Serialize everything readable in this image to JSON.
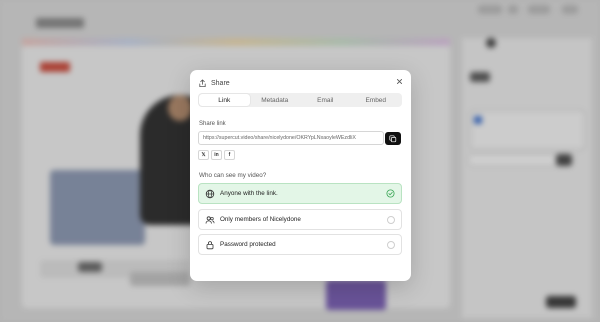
{
  "modal": {
    "title": "Share",
    "icons": {
      "share": "share-icon",
      "close": "close-icon",
      "copy": "copy-icon"
    },
    "tabs": [
      {
        "label": "Link",
        "active": true
      },
      {
        "label": "Metadata",
        "active": false
      },
      {
        "label": "Email",
        "active": false
      },
      {
        "label": "Embed",
        "active": false
      }
    ],
    "share_link_label": "Share link",
    "share_link_value": "https://supercut.video/share/nicelydone/OKRYpLNxaoyleWEzdliX",
    "socials": [
      {
        "label": "𝕏",
        "icon": "x-icon"
      },
      {
        "label": "in",
        "icon": "linkedin-icon"
      },
      {
        "label": "f",
        "icon": "facebook-icon"
      }
    ],
    "visibility_label": "Who can see my video?",
    "options": [
      {
        "label": "Anyone with the link.",
        "icon": "globe-icon",
        "selected": true
      },
      {
        "label": "Only members of Nicelydone",
        "icon": "users-icon",
        "selected": false
      },
      {
        "label": "Password protected",
        "icon": "lock-icon",
        "selected": false
      }
    ],
    "colors": {
      "selected_bg": "#e3f6e7",
      "selected_check": "#3aa655",
      "copy_bg": "#111111"
    }
  }
}
